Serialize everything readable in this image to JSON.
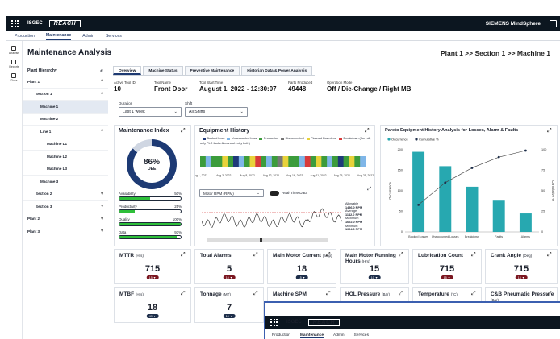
{
  "header": {
    "brand": "ISGEC",
    "product": "REACH",
    "vendor": "SIEMENS MindSphere",
    "tabs": [
      "Production",
      "Maintenance",
      "Admin",
      "Services"
    ],
    "active_tab": "Maintenance"
  },
  "rail": [
    {
      "icon": "analysis-icon",
      "label": "Analysis"
    },
    {
      "icon": "reports-icon",
      "label": "Reports"
    },
    {
      "icon": "docs-icon",
      "label": "Docs"
    }
  ],
  "page_title": "Maintenance Analysis",
  "breadcrumb": "Plant 1 >> Section 1 >> Machine 1",
  "hierarchy": {
    "title": "Plant Hierarchy",
    "collapse_icon": "double-chevron-left-icon",
    "items": [
      {
        "label": "Plant 1",
        "chev": "^"
      },
      {
        "label": "Section 1",
        "chev": "^"
      },
      {
        "label": "Machine 1",
        "chev": ""
      },
      {
        "label": "Machine 2",
        "chev": ""
      },
      {
        "label": "Line 1",
        "chev": "^"
      },
      {
        "label": "Machine L1",
        "chev": ""
      },
      {
        "label": "Machine L2",
        "chev": ""
      },
      {
        "label": "Machine L3",
        "chev": ""
      },
      {
        "label": "Machine 3",
        "chev": ""
      },
      {
        "label": "Section 2",
        "chev": "v"
      },
      {
        "label": "Section 3",
        "chev": "v"
      },
      {
        "label": "Plant 2",
        "chev": "v"
      },
      {
        "label": "Plant 3",
        "chev": "v"
      }
    ]
  },
  "main_tabs": [
    "Overview",
    "Machine Status",
    "Preventive Maintenance",
    "Historian Data & Power Analysis"
  ],
  "info": {
    "active_tool_id_label": "Active Tool ID",
    "active_tool_id": "10",
    "tool_name_label": "Tool Name",
    "tool_name": "Front Door",
    "tool_start_label": "Tool Start Time",
    "tool_start": "August 1, 2022 - 12:30:07",
    "parts_label": "Parts Produced",
    "parts": "49448",
    "mode_label": "Operation Mode",
    "mode": "Off / Die-Change / Right MB"
  },
  "filters": {
    "duration_label": "Duration",
    "duration": "Last 1 week",
    "shift_label": "Shift",
    "shift": "All Shifts"
  },
  "maintenance_index": {
    "title": "Maintenance Index",
    "value": "86%",
    "gauge_fraction": 0.86,
    "gauge_label": "OEE",
    "metrics": [
      {
        "label": "Availability",
        "value": "50%",
        "fill": 0.5
      },
      {
        "label": "Productivity",
        "value": "25%",
        "fill": 0.25
      },
      {
        "label": "Quality",
        "value": "100%",
        "fill": 1.0
      },
      {
        "label": "Data",
        "value": "93%",
        "fill": 0.93
      }
    ]
  },
  "equipment_history": {
    "title": "Equipment History",
    "legend": [
      "Booked Loss",
      "Unaccounted Loss",
      "Production",
      "Disconnected",
      "Planned Downtime",
      "Breakdown ( for roll, only PLC faults & manual entry both)"
    ],
    "legend_colors": [
      "#1f3a7a",
      "#7fb6e8",
      "#3c9c3c",
      "#777777",
      "#e8d23a",
      "#d83a3a"
    ],
    "dates": [
      "Aug 1, 2022",
      "Aug 3, 2022",
      "Aug 8, 2022",
      "Aug 12, 2022",
      "Aug 16, 2022",
      "Aug 21, 2022",
      "Aug 25, 2022",
      "Aug 29, 2022"
    ],
    "motor_select": "Motor RPM (RPM)",
    "realtime_label": "Real-Time Data",
    "stats": [
      {
        "label": "Allowable",
        "value": "1456.0 RPM"
      },
      {
        "label": "Average",
        "value": "1142.0 RPM"
      },
      {
        "label": "Maximum",
        "value": "1622.0 RPM"
      },
      {
        "label": "Minimum",
        "value": "1004.0 RPM"
      }
    ]
  },
  "pareto": {
    "title": "Pareto Equipment History Analysis for Losses, Alarm & Faults"
  },
  "chart_data": {
    "type": "bar",
    "categories": [
      "Booked Losses",
      "Unaccounted Losses",
      "Breakdown",
      "Faults",
      "Alarms"
    ],
    "series": [
      {
        "name": "Occurrence",
        "values": [
          195,
          160,
          110,
          78,
          45
        ]
      },
      {
        "name": "Cumulative %",
        "values": [
          33,
          60,
          78,
          91,
          99
        ]
      }
    ],
    "xlabel": "",
    "ylabel": "Occurrence",
    "y2label": "Cumulative %",
    "ylim": [
      0,
      200
    ],
    "y2lim": [
      0,
      100
    ],
    "yticks": [
      "200",
      "150",
      "100",
      "50",
      "0"
    ],
    "y2ticks": [
      "100",
      "75",
      "50",
      "25",
      "0"
    ],
    "legend_position": "top-left"
  },
  "kpis_row1": [
    {
      "title": "MTTR",
      "unit": "(Hrs)",
      "value": "715",
      "badge": "15 ▼",
      "badge_dark": false
    },
    {
      "title": "Total Alarms",
      "unit": "",
      "value": "5",
      "badge": "10 ▼",
      "badge_dark": false
    },
    {
      "title": "Main Motor Current",
      "unit": "(amp)",
      "value": "18",
      "badge": "15 ▼",
      "badge_dark": true
    },
    {
      "title": "Main Motor Running Hours",
      "unit": "(Hrs)",
      "value": "15",
      "badge": "10 ▼",
      "badge_dark": true
    },
    {
      "title": "Lubrication Count",
      "unit": "",
      "value": "715",
      "badge": "15 ▼",
      "badge_dark": false
    },
    {
      "title": "Crank Angle",
      "unit": "(Deg)",
      "value": "715",
      "badge": "15 ▼",
      "badge_dark": false
    }
  ],
  "kpis_row2": [
    {
      "title": "MTBF",
      "unit": "(Hrs)",
      "value": "18",
      "badge": "49 ▼",
      "badge_dark": true
    },
    {
      "title": "Tonnage",
      "unit": "(MT)",
      "value": "7",
      "badge": "10 ▼",
      "badge_dark": true
    },
    {
      "title": "Machine SPM",
      "unit": "",
      "value": "",
      "badge": "",
      "badge_dark": false
    },
    {
      "title": "HOL Pressure",
      "unit": "(Bar)",
      "value": "",
      "badge": "",
      "badge_dark": false
    },
    {
      "title": "Temperature",
      "unit": "(°C)",
      "value": "",
      "badge": "",
      "badge_dark": false
    },
    {
      "title": "C&B Pneumatic Pressure",
      "unit": "(Bar)",
      "value": "",
      "badge": "",
      "badge_dark": false
    }
  ],
  "overlay": {
    "brand": "ISGEC",
    "product": "REACH",
    "tabs": [
      "Production",
      "Maintenance",
      "Admin",
      "Services"
    ]
  }
}
